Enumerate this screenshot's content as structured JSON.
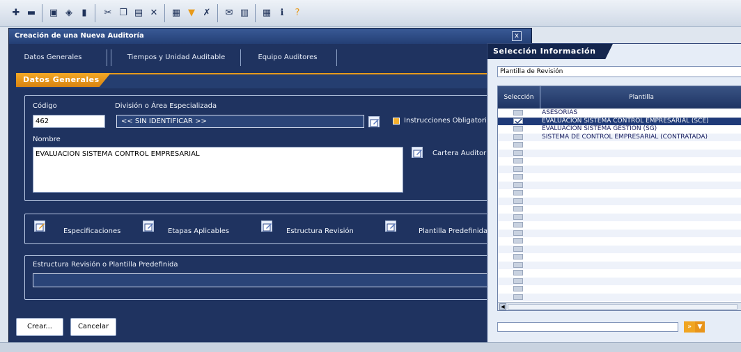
{
  "toolbar": {
    "icons": [
      "new-document-icon",
      "open-folder-icon",
      "print-icon",
      "edit-icon",
      "bookmark-icon",
      "cut-icon",
      "copy-icon",
      "paste-icon",
      "delete-icon",
      "refresh-icon",
      "filter-icon",
      "clear-filter-icon",
      "mail-icon",
      "documents-icon",
      "grid-view-icon",
      "info-icon",
      "help-icon"
    ]
  },
  "dialog": {
    "title": "Creación de una Nueva Auditoría",
    "close_label": "x",
    "tabs": [
      {
        "label": "Datos Generales"
      },
      {
        "label": "Tiempos y Unidad Auditable"
      },
      {
        "label": "Equipo Auditores"
      }
    ],
    "section_title": "Datos Generales",
    "codigo_label": "Código",
    "codigo_value": "462",
    "division_label": "División o Área Especializada",
    "division_value": "<< SIN IDENTIFICAR >>",
    "instrucciones_label": "Instrucciones Obligatorias",
    "nombre_label": "Nombre",
    "nombre_value": "EVALUACION SISTEMA CONTROL EMPRESARIAL",
    "cartera_label": "Cartera Auditoría",
    "actions": [
      {
        "label": "Especificaciones"
      },
      {
        "label": "Etapas Aplicables"
      },
      {
        "label": "Estructura Revisión"
      },
      {
        "label": "Plantilla Predefinida"
      }
    ],
    "estructura_label": "Estructura Revisión o Plantilla Predefinida",
    "crear_label": "Crear...",
    "cancelar_label": "Cancelar"
  },
  "panel": {
    "title": "Selección Información",
    "select_value": "Plantilla de Revisión",
    "col_seleccion": "Selección",
    "col_plantilla": "Plantilla",
    "rows": [
      {
        "label": "ASESORIAS",
        "checked": false
      },
      {
        "label": "EVALUACION SISTEMA CONTROL EMPRESARIAL (SCE)",
        "checked": true
      },
      {
        "label": "EVALUACION SISTEMA GESTION (SG)",
        "checked": false
      },
      {
        "label": "SISTEMA DE CONTROL EMPRESARIAL (CONTRATADA)",
        "checked": false
      }
    ],
    "empty_rows": 21
  },
  "colors": {
    "dialog_bg": "#1f3360",
    "accent_orange": "#f0a522",
    "selected_row": "#1f3a78"
  }
}
